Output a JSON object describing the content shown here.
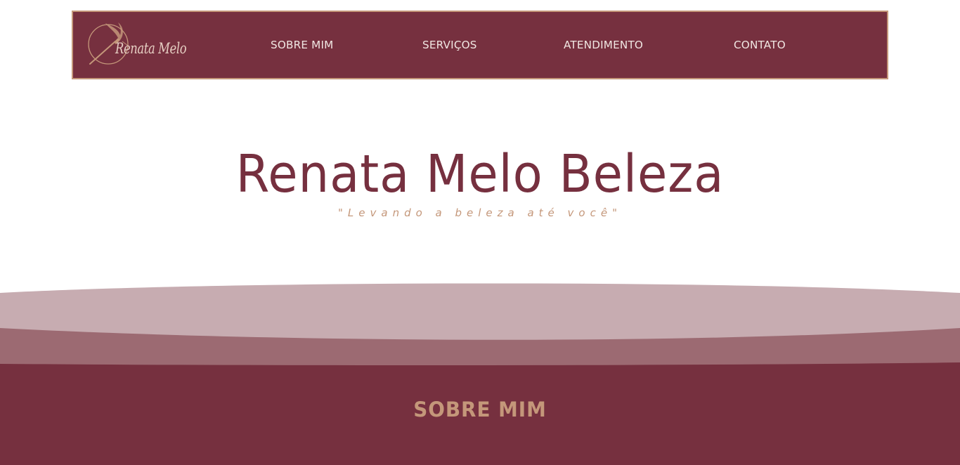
{
  "colors": {
    "brand": "#76303f",
    "accent": "#c4977a",
    "nav_text": "#f1e7e3",
    "wave_light": "#c7acb1",
    "wave_mid": "#9c6a72",
    "background": "#ffffff"
  },
  "header": {
    "logo_text": "Renata Melo",
    "logo_icon": "makeup-brush-logo-icon",
    "nav": [
      {
        "label": "SOBRE MIM"
      },
      {
        "label": "SERVIÇOS"
      },
      {
        "label": "ATENDIMENTO"
      },
      {
        "label": "CONTATO"
      }
    ]
  },
  "hero": {
    "title": "Renata Melo Beleza",
    "subtitle": "\"Levando a beleza até você\""
  },
  "about": {
    "title": "SOBRE MIM"
  }
}
